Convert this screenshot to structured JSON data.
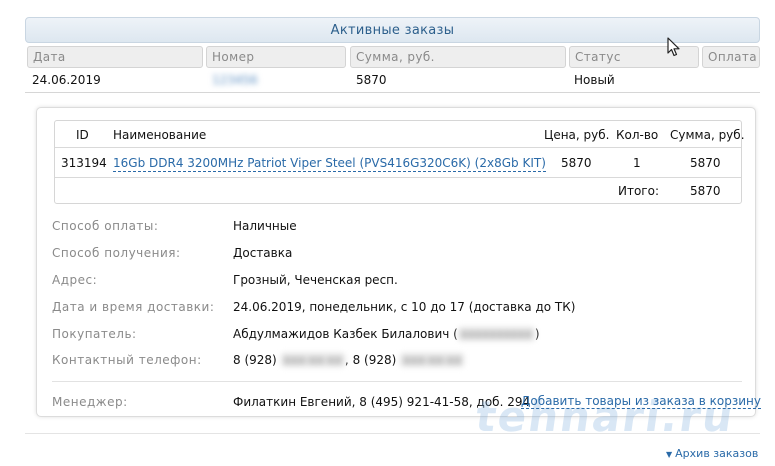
{
  "panel": {
    "title": "Активные заказы"
  },
  "orders_table": {
    "headers": {
      "date": "Дата",
      "number": "Номер",
      "sum": "Сумма, руб.",
      "status": "Статус",
      "payment": "Оплата"
    },
    "row": {
      "date": "24.06.2019",
      "number": "123456",
      "sum": "5870",
      "status": "Новый"
    }
  },
  "items_table": {
    "headers": {
      "id": "ID",
      "name": "Наименование",
      "price": "Цена, руб.",
      "qty": "Кол-во",
      "total": "Сумма, руб."
    },
    "items": [
      {
        "id": "313194",
        "name": "16Gb DDR4 3200MHz Patriot Viper Steel (PVS416G320C6K) (2x8Gb KIT)",
        "price": "5870",
        "qty": "1",
        "total": "5870"
      }
    ],
    "total_label": "Итого:",
    "total_value": "5870"
  },
  "details": {
    "payment_label": "Способ оплаты:",
    "payment_value": "Наличные",
    "delivery_label": "Способ получения:",
    "delivery_value": "Доставка",
    "address_label": "Адрес:",
    "address_value": "Грозный, Чеченская респ.",
    "datetime_label": "Дата и время доставки:",
    "datetime_value": "24.06.2019, понедельник, с 10 до 17 (доставка до ТК)",
    "buyer_label": "Покупатель:",
    "buyer_name": "Абдулмажидов Казбек Билалович (",
    "buyer_masked": "xxxxxxxxxx",
    "buyer_close": ")",
    "phone_label": "Контактный телефон:",
    "phone1_prefix": "8 (928)",
    "phone1_masked": "xxx-xx-xx",
    "phone_sep": ", ",
    "phone2_prefix": "8 (928)",
    "phone2_masked": "xxx-xx-xx",
    "manager_label": "Менеджер:",
    "manager_value": "Филаткин Евгений, 8 (495) 921-41-58, доб. 294",
    "add_to_cart": "Добавить товары из заказа в корзину"
  },
  "watermark": "tehnari.ru",
  "archive_link": "Архив заказов"
}
